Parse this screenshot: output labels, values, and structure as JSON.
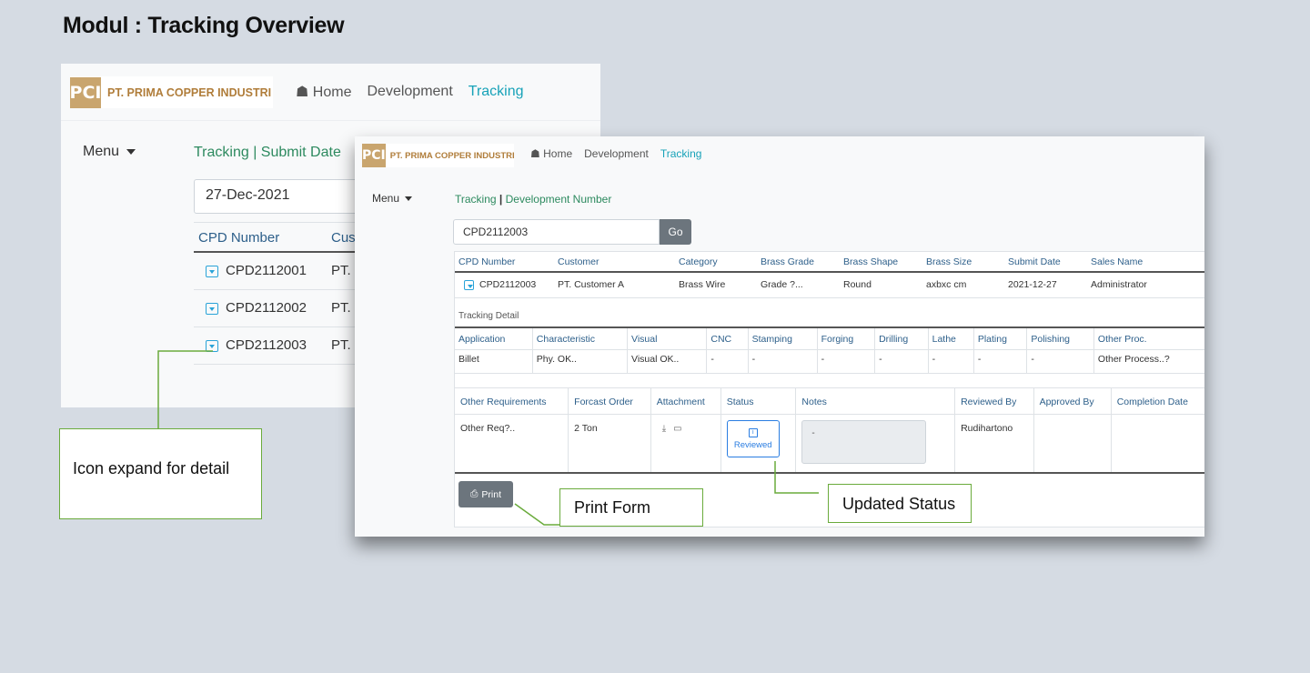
{
  "page_title": "Modul : Tracking Overview",
  "brand": {
    "logo_text": "PCI",
    "name": "PT. PRIMA COPPER INDUSTRI"
  },
  "nav": {
    "home": "Home",
    "development": "Development",
    "tracking": "Tracking"
  },
  "menu_label": "Menu",
  "back": {
    "breadcrumb": "Tracking | Submit Date",
    "date_value": "27-Dec-2021",
    "columns": [
      "CPD Number",
      "Cust"
    ],
    "rows": [
      {
        "cpd": "CPD2112001",
        "customer": "PT. C"
      },
      {
        "cpd": "CPD2112002",
        "customer": "PT. C"
      },
      {
        "cpd": "CPD2112003",
        "customer": "PT. C"
      }
    ]
  },
  "front": {
    "breadcrumb_left": "Tracking",
    "breadcrumb_sep": "|",
    "breadcrumb_right": "Development Number",
    "search_value": "CPD2112003",
    "go_label": "Go",
    "columns": [
      "CPD Number",
      "Customer",
      "Category",
      "Brass Grade",
      "Brass Shape",
      "Brass Size",
      "Submit Date",
      "Sales Name"
    ],
    "row": [
      "CPD2112003",
      "PT. Customer A",
      "Brass Wire",
      "Grade ?...",
      "Round",
      "axbxc cm",
      "2021-12-27",
      "Administrator"
    ],
    "detail_label": "Tracking Detail",
    "detail_columns": [
      "Application",
      "Characteristic",
      "Visual",
      "CNC",
      "Stamping",
      "Forging",
      "Drilling",
      "Lathe",
      "Plating",
      "Polishing",
      "Other Proc."
    ],
    "detail_row": [
      "Billet",
      "Phy. OK..",
      "Visual OK..",
      "-",
      "-",
      "-",
      "-",
      "-",
      "-",
      "-",
      "Other Process..?"
    ],
    "req_columns": [
      "Other Requirements",
      "Forcast Order",
      "Attachment",
      "Status",
      "Notes",
      "Reviewed By",
      "Approved By",
      "Completion Date"
    ],
    "req_row": {
      "other_req": "Other Req?..",
      "forecast": "2 Ton",
      "status": "Reviewed",
      "notes": "-",
      "reviewed_by": "Rudihartono",
      "approved_by": "",
      "completion_date": ""
    },
    "print_label": "Print"
  },
  "callouts": {
    "expand": "Icon expand for detail",
    "print": "Print Form",
    "status": "Updated Status"
  },
  "colors": {
    "accent": "#17a2b8",
    "callout_border": "#6aab3c",
    "brand": "#b07d3a",
    "link_green": "#2d8a5f"
  }
}
